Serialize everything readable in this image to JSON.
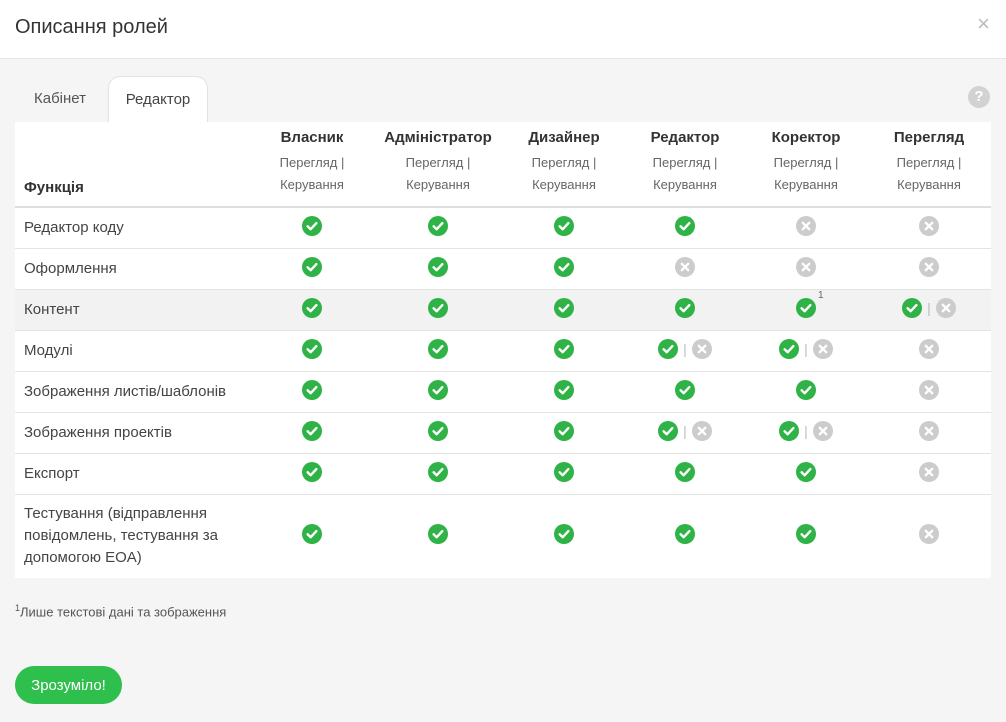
{
  "modal": {
    "title": "Описання ролей",
    "close": "×",
    "help": "?"
  },
  "tabs": [
    {
      "label": "Кабінет",
      "active": false
    },
    {
      "label": "Редактор",
      "active": true
    }
  ],
  "table": {
    "function_header": "Функція",
    "roles": [
      {
        "name": "Власник",
        "sub1": "Перегляд |",
        "sub2": "Керування"
      },
      {
        "name": "Адміністратор",
        "sub1": "Перегляд |",
        "sub2": "Керування"
      },
      {
        "name": "Дизайнер",
        "sub1": "Перегляд |",
        "sub2": "Керування"
      },
      {
        "name": "Редактор",
        "sub1": "Перегляд |",
        "sub2": "Керування"
      },
      {
        "name": "Коректор",
        "sub1": "Перегляд |",
        "sub2": "Керування"
      },
      {
        "name": "Перегляд",
        "sub1": "Перегляд |",
        "sub2": "Керування"
      }
    ],
    "rows": [
      {
        "function": "Редактор коду",
        "cells": [
          "yes",
          "yes",
          "yes",
          "yes",
          "no",
          "no"
        ]
      },
      {
        "function": "Оформлення",
        "cells": [
          "yes",
          "yes",
          "yes",
          "no",
          "no",
          "no"
        ]
      },
      {
        "function": "Контент",
        "cells": [
          "yes",
          "yes",
          "yes",
          "yes",
          "yes",
          "partial"
        ],
        "notes": {
          "4": "1"
        }
      },
      {
        "function": "Модулі",
        "cells": [
          "yes",
          "yes",
          "yes",
          "partial",
          "partial",
          "no"
        ]
      },
      {
        "function": "Зображення листів/шаблонів",
        "cells": [
          "yes",
          "yes",
          "yes",
          "yes",
          "yes",
          "no"
        ]
      },
      {
        "function": "Зображення проектів",
        "cells": [
          "yes",
          "yes",
          "yes",
          "partial",
          "partial",
          "no"
        ]
      },
      {
        "function": "Експорт",
        "cells": [
          "yes",
          "yes",
          "yes",
          "yes",
          "yes",
          "no"
        ]
      },
      {
        "function": "Тестування (відправлення повідомлень, тестування за допомогою EOA)",
        "cells": [
          "yes",
          "yes",
          "yes",
          "yes",
          "yes",
          "no"
        ]
      }
    ],
    "partial_separator": "|"
  },
  "footnote": {
    "marker": "1",
    "text": "Лише текстові дані та зображення"
  },
  "ok_button": {
    "label": "Зрозуміло!"
  },
  "colors": {
    "check": "#2fb347",
    "cross": "#cccccc",
    "button": "#2fbf4d"
  },
  "icons": {
    "yes": "check-circle-icon",
    "no": "cross-circle-icon"
  }
}
